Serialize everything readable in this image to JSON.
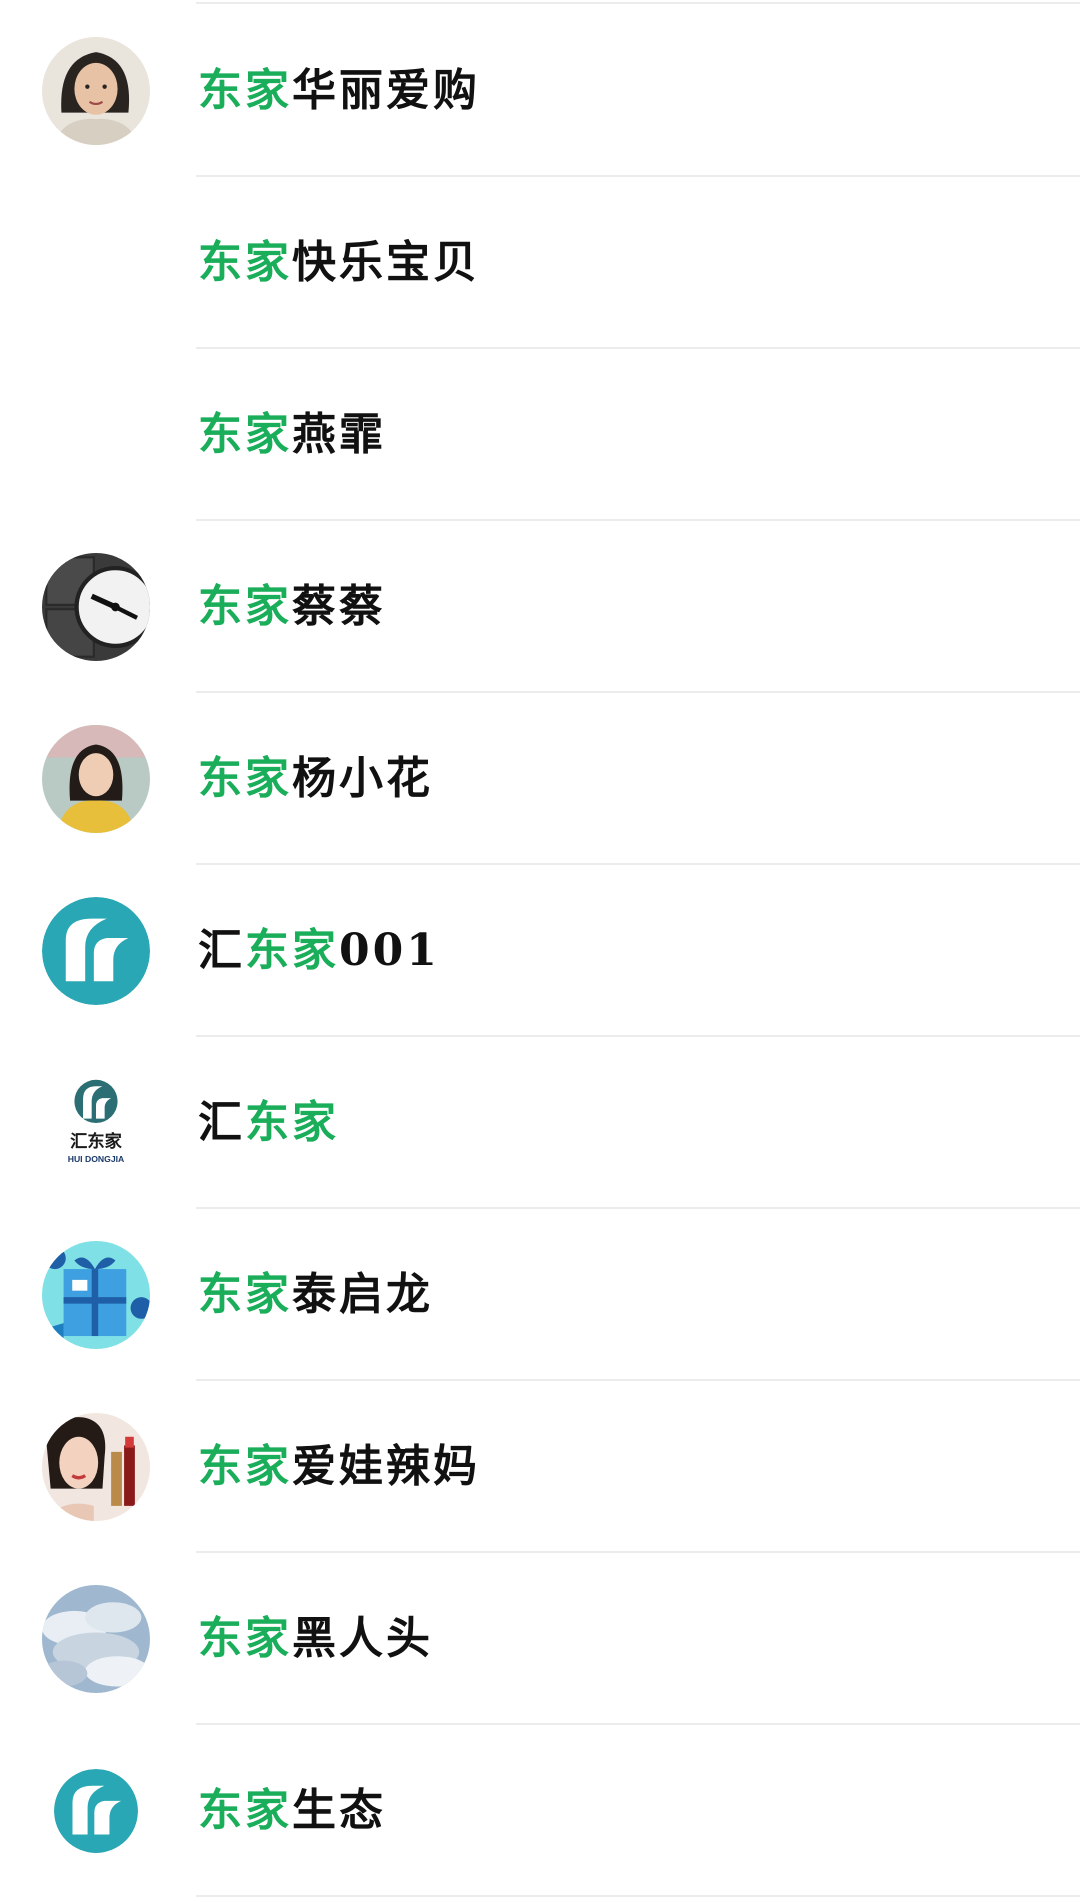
{
  "accent_color": "#1aad5a",
  "contacts": [
    {
      "highlight": "东家",
      "prefix": "",
      "suffix": "华丽爱购",
      "avatar": "woman-photo-avatar"
    },
    {
      "highlight": "东家",
      "prefix": "",
      "suffix": "快乐宝贝",
      "avatar": "blank-avatar"
    },
    {
      "highlight": "东家",
      "prefix": "",
      "suffix": "燕霏",
      "avatar": "blank-avatar"
    },
    {
      "highlight": "东家",
      "prefix": "",
      "suffix": "蔡蔡",
      "avatar": "clock-avatar"
    },
    {
      "highlight": "东家",
      "prefix": "",
      "suffix": "杨小花",
      "avatar": "woman-yellow-avatar"
    },
    {
      "highlight": "东家",
      "prefix": "汇",
      "suffix": "001",
      "avatar": "teal-logo-avatar"
    },
    {
      "highlight": "东家",
      "prefix": "汇",
      "suffix": "",
      "avatar": "huidongjia-logo-avatar",
      "logo_text": "汇东家",
      "logo_subtext": "HUI DONGJIA"
    },
    {
      "highlight": "东家",
      "prefix": "",
      "suffix": "泰启龙",
      "avatar": "gift-avatar"
    },
    {
      "highlight": "东家",
      "prefix": "",
      "suffix": "爱娃辣妈",
      "avatar": "lipstick-avatar"
    },
    {
      "highlight": "东家",
      "prefix": "",
      "suffix": "黑人头",
      "avatar": "clouds-avatar"
    },
    {
      "highlight": "东家",
      "prefix": "",
      "suffix": "生态",
      "avatar": "teal-logo-small-avatar"
    }
  ]
}
